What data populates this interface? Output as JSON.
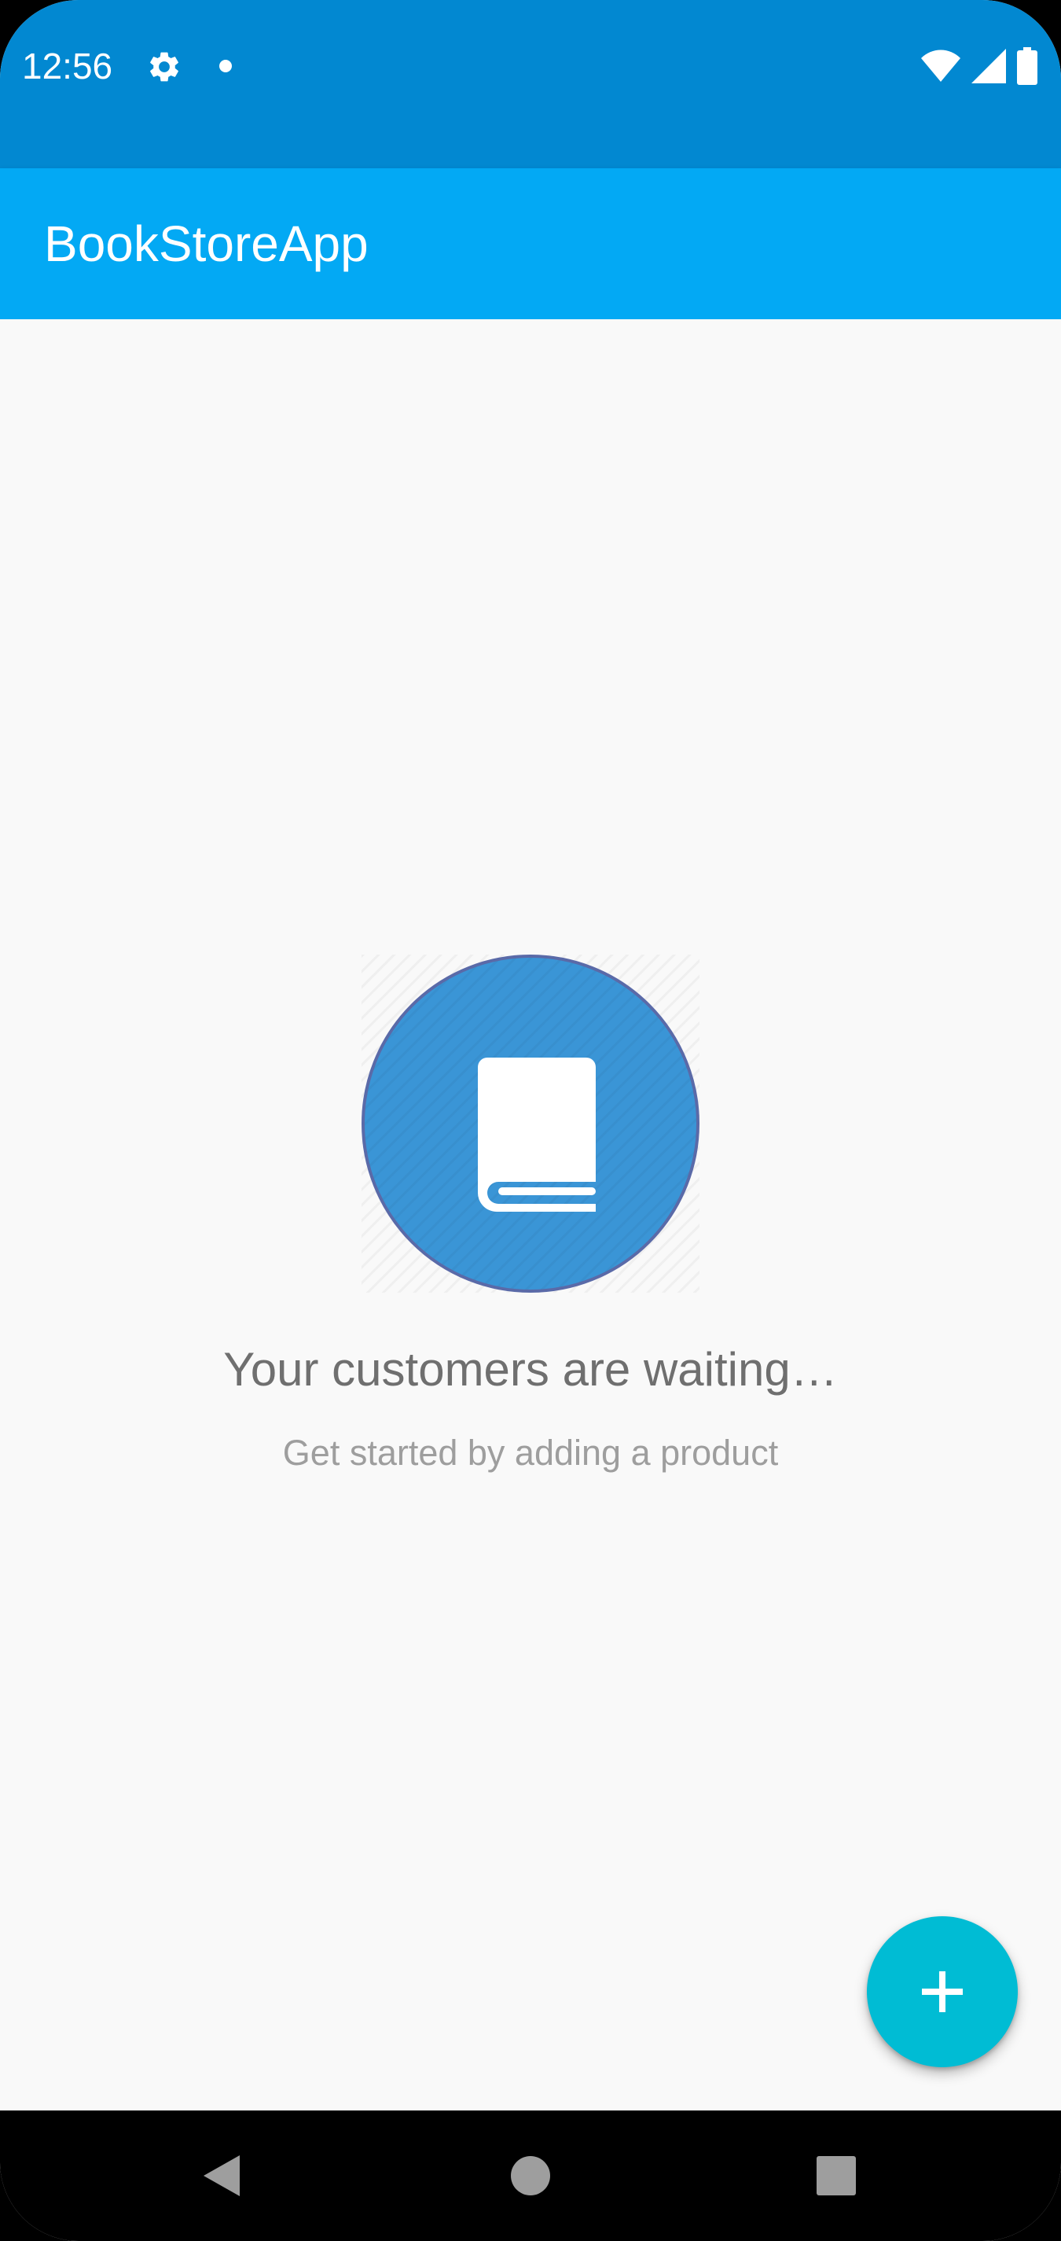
{
  "status_bar": {
    "time": "12:56",
    "icons": [
      "settings-icon",
      "notification-dot-icon",
      "wifi-icon",
      "cell-signal-icon",
      "battery-icon"
    ]
  },
  "app_bar": {
    "title": "BookStoreApp"
  },
  "empty_state": {
    "icon": "book-icon",
    "title": "Your customers are waiting…",
    "subtitle": "Get started by adding a product"
  },
  "fab": {
    "icon": "plus-icon"
  },
  "nav_bar": {
    "buttons": [
      "back-icon",
      "home-icon",
      "recents-icon"
    ]
  },
  "colors": {
    "status_bar": "#0288d1",
    "app_bar": "#03a9f4",
    "background": "#f9f9f9",
    "book_circle": "#3a95d6",
    "fab": "#00bcd4"
  }
}
